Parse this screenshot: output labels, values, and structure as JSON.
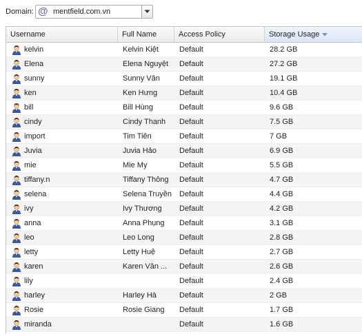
{
  "toolbar": {
    "domain_label": "Domain:",
    "domain_value": "mentfield.com.vn",
    "domain_icon": "at-icon"
  },
  "grid": {
    "columns": [
      {
        "label": "Username"
      },
      {
        "label": "Full Name"
      },
      {
        "label": "Access Policy"
      },
      {
        "label": "Storage Usage",
        "sorted": "descending"
      }
    ],
    "rows": [
      {
        "username": "kelvin",
        "full_name": "Kelvin Kiệt",
        "policy": "Default",
        "storage": "28.2 GB"
      },
      {
        "username": "Elena",
        "full_name": "Elena Nguyệt",
        "policy": "Default",
        "storage": "27.2 GB"
      },
      {
        "username": "sunny",
        "full_name": "Sunny Vân",
        "policy": "Default",
        "storage": "19.1 GB"
      },
      {
        "username": "ken",
        "full_name": "Ken Hưng",
        "policy": "Default",
        "storage": "10.4 GB"
      },
      {
        "username": "bill",
        "full_name": "Bill Hùng",
        "policy": "Default",
        "storage": "9.6 GB"
      },
      {
        "username": "cindy",
        "full_name": "Cindy Thanh",
        "policy": "Default",
        "storage": "7.5 GB"
      },
      {
        "username": "import",
        "full_name": "Tim Tiên",
        "policy": "Default",
        "storage": "7 GB"
      },
      {
        "username": "Juvia",
        "full_name": "Juvia Hảo",
        "policy": "Default",
        "storage": "6.9 GB"
      },
      {
        "username": "mie",
        "full_name": "Mie My",
        "policy": "Default",
        "storage": "5.5 GB"
      },
      {
        "username": "tiffany.n",
        "full_name": "Tiffany Thông",
        "policy": "Default",
        "storage": "4.7 GB"
      },
      {
        "username": "selena",
        "full_name": "Selena Truyền",
        "policy": "Default",
        "storage": "4.4 GB"
      },
      {
        "username": "ivy",
        "full_name": "Ivy Thương",
        "policy": "Default",
        "storage": "4.2 GB"
      },
      {
        "username": "anna",
        "full_name": "Anna Phụng",
        "policy": "Default",
        "storage": "3.1 GB"
      },
      {
        "username": "leo",
        "full_name": "Leo Long",
        "policy": "Default",
        "storage": "2.8 GB"
      },
      {
        "username": "letty",
        "full_name": "Letty Huệ",
        "policy": "Default",
        "storage": "2.7 GB"
      },
      {
        "username": "karen",
        "full_name": "Karen Vân ...",
        "policy": "Default",
        "storage": "2.6 GB"
      },
      {
        "username": "lily",
        "full_name": "",
        "policy": "Default",
        "storage": "2.4 GB"
      },
      {
        "username": "harley",
        "full_name": "Harley Hà",
        "policy": "Default",
        "storage": "2 GB"
      },
      {
        "username": "Rosie",
        "full_name": "Rosie Giang",
        "policy": "Default",
        "storage": "1.7 GB"
      },
      {
        "username": "miranda",
        "full_name": "",
        "policy": "Default",
        "storage": "1.6 GB"
      }
    ]
  },
  "colors": {
    "accent": "#7b67b8",
    "sort_arrow": "#6e93c2",
    "row_alt": "#f4f4f4"
  }
}
